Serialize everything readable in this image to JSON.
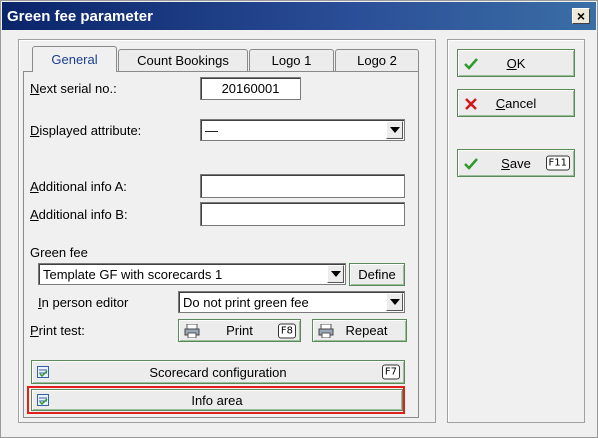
{
  "window": {
    "title": "Green fee parameter",
    "close_label": "×"
  },
  "tabs": [
    {
      "label": "General",
      "active": true
    },
    {
      "label": "Count Bookings",
      "active": false
    },
    {
      "label": "Logo 1",
      "active": false
    },
    {
      "label": "Logo 2",
      "active": false
    }
  ],
  "form": {
    "next_serial_label_u": "N",
    "next_serial_label_rest": "ext serial no.:",
    "next_serial_value": "20160001",
    "displayed_attr_label_u": "D",
    "displayed_attr_label_rest": "isplayed attribute:",
    "displayed_attr_value": "—",
    "info_a_label_u": "A",
    "info_a_label_rest": "dditional info A:",
    "info_a_value": "",
    "info_b_label_u": "A",
    "info_b_label_rest": "dditional info B:",
    "info_b_value": "",
    "green_fee_label": "Green fee",
    "green_fee_value": "Template GF with scorecards 1",
    "define_label": "Define",
    "person_editor_label_u": "I",
    "person_editor_label_rest": "n person editor",
    "person_editor_value": "Do not print green fee",
    "print_test_label_u": "P",
    "print_test_label_rest": "rint test:",
    "print_label": "Print",
    "print_key": "F8",
    "repeat_label": "Repeat",
    "scorecard_label": "Scorecard configuration",
    "scorecard_key": "F7",
    "info_area_label": "Info area"
  },
  "actions": {
    "ok_label_u": "O",
    "ok_label_rest": "K",
    "cancel_label_u": "C",
    "cancel_label_rest": "ancel",
    "save_label_u": "S",
    "save_label_rest": "ave",
    "save_key": "F11"
  },
  "colors": {
    "accent_green": "#2e9a2e",
    "cancel_red": "#d01818",
    "highlight": "#e0201a"
  }
}
